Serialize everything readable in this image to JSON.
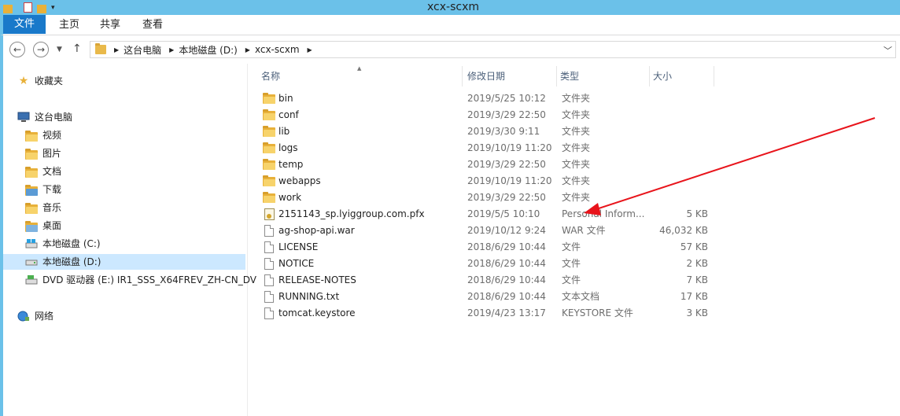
{
  "window": {
    "title": "xcx-scxm"
  },
  "ribbon": {
    "tabs": [
      "文件",
      "主页",
      "共享",
      "查看"
    ]
  },
  "address": {
    "crumbs": [
      "这台电脑",
      "本地磁盘 (D:)",
      "xcx-scxm"
    ]
  },
  "nav": {
    "favorites": "收藏夹",
    "this_pc": "这台电脑",
    "items": [
      "视频",
      "图片",
      "文档",
      "下载",
      "音乐",
      "桌面",
      "本地磁盘 (C:)",
      "本地磁盘 (D:)",
      "DVD 驱动器 (E:) IR1_SSS_X64FREV_ZH-CN_DV"
    ],
    "network": "网络"
  },
  "columns": {
    "name": "名称",
    "date": "修改日期",
    "type": "类型",
    "size": "大小"
  },
  "files": [
    {
      "name": "bin",
      "date": "2019/5/25 10:12",
      "type": "文件夹",
      "size": "",
      "kind": "folder"
    },
    {
      "name": "conf",
      "date": "2019/3/29 22:50",
      "type": "文件夹",
      "size": "",
      "kind": "folder"
    },
    {
      "name": "lib",
      "date": "2019/3/30 9:11",
      "type": "文件夹",
      "size": "",
      "kind": "folder"
    },
    {
      "name": "logs",
      "date": "2019/10/19 11:20",
      "type": "文件夹",
      "size": "",
      "kind": "folder"
    },
    {
      "name": "temp",
      "date": "2019/3/29 22:50",
      "type": "文件夹",
      "size": "",
      "kind": "folder"
    },
    {
      "name": "webapps",
      "date": "2019/10/19 11:20",
      "type": "文件夹",
      "size": "",
      "kind": "folder"
    },
    {
      "name": "work",
      "date": "2019/3/29 22:50",
      "type": "文件夹",
      "size": "",
      "kind": "folder"
    },
    {
      "name": "2151143_sp.lyiggroup.com.pfx",
      "date": "2019/5/5 10:10",
      "type": "Personal Inform...",
      "size": "5 KB",
      "kind": "cert"
    },
    {
      "name": "ag-shop-api.war",
      "date": "2019/10/12 9:24",
      "type": "WAR 文件",
      "size": "46,032 KB",
      "kind": "file"
    },
    {
      "name": "LICENSE",
      "date": "2018/6/29 10:44",
      "type": "文件",
      "size": "57 KB",
      "kind": "file"
    },
    {
      "name": "NOTICE",
      "date": "2018/6/29 10:44",
      "type": "文件",
      "size": "2 KB",
      "kind": "file"
    },
    {
      "name": "RELEASE-NOTES",
      "date": "2018/6/29 10:44",
      "type": "文件",
      "size": "7 KB",
      "kind": "file"
    },
    {
      "name": "RUNNING.txt",
      "date": "2018/6/29 10:44",
      "type": "文本文档",
      "size": "17 KB",
      "kind": "file"
    },
    {
      "name": "tomcat.keystore",
      "date": "2019/4/23 13:17",
      "type": "KEYSTORE 文件",
      "size": "3 KB",
      "kind": "file"
    }
  ],
  "annotation": {
    "color": "#e8141b",
    "target": "2151143_sp.lyiggroup.com.pfx"
  }
}
